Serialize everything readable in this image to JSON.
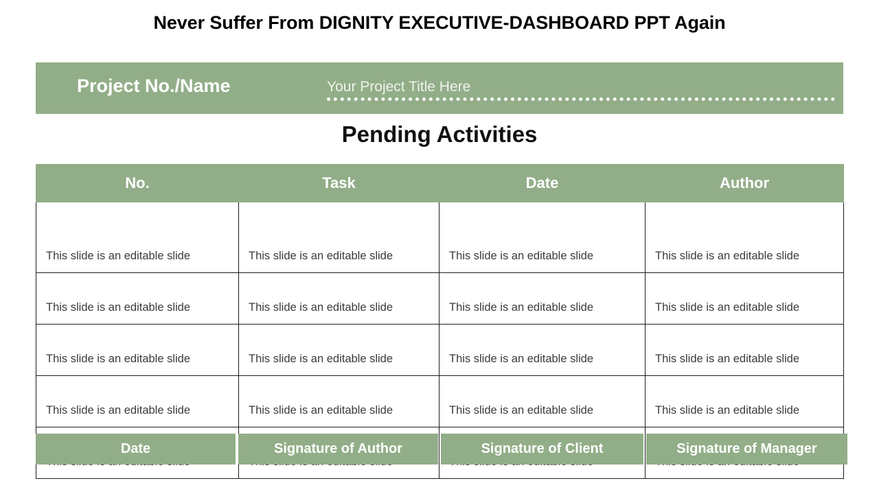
{
  "slide": {
    "title": "Never Suffer From DIGNITY EXECUTIVE-DASHBOARD PPT Again",
    "section_heading": "Pending Activities"
  },
  "project_banner": {
    "label": "Project No./Name",
    "title_value": "Your Project Title Here",
    "title_placeholder": "Your Project Title Here",
    "background_color": "#92ae88",
    "text_color": "#ffffff"
  },
  "table": {
    "headers": [
      "No.",
      "Task",
      "Date",
      "Author"
    ],
    "rows": [
      [
        "This slide is an editable slide",
        "This slide is an editable slide",
        "This slide is an editable slide",
        "This slide is an editable slide"
      ],
      [
        "This slide is an editable slide",
        "This slide is an editable slide",
        "This slide is an editable slide",
        "This slide is an editable slide"
      ],
      [
        "This slide is an editable slide",
        "This slide is an editable slide",
        "This slide is an editable slide",
        "This slide is an editable slide"
      ],
      [
        "This slide is an editable slide",
        "This slide is an editable slide",
        "This slide is an editable slide",
        "This slide is an editable slide"
      ],
      [
        "This slide is an editable slide",
        "This slide is an editable slide",
        "This slide is an editable slide",
        "This slide is an editable slide"
      ]
    ],
    "header_background_color": "#92ae88",
    "header_text_color": "#ffffff",
    "cell_text_color": "#3a3a3a",
    "border_color": "#1d1d1d"
  },
  "signature_row": {
    "cells": [
      "Date",
      "Signature of Author",
      "Signature of Client",
      "Signature of Manager"
    ],
    "background_color": "#92ae88",
    "text_color": "#ffffff"
  }
}
